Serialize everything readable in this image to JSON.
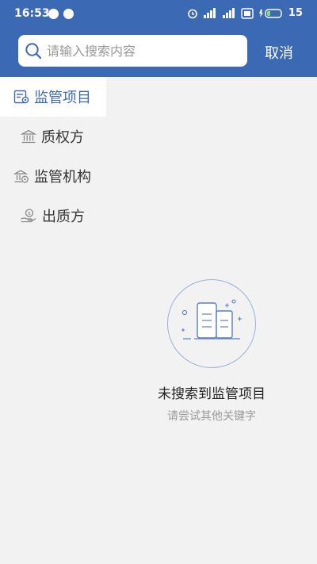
{
  "status_bar": {
    "time": "16:53",
    "battery": "15",
    "icons": [
      "message-icon",
      "media-icon",
      "alarm-icon",
      "signal-icon",
      "signal-icon",
      "sim-icon",
      "battery-icon"
    ]
  },
  "search": {
    "placeholder": "请输入搜索内容",
    "value": "",
    "cancel_label": "取消"
  },
  "categories": [
    {
      "label": "监管项目",
      "icon": "project-icon",
      "active": true
    },
    {
      "label": "质权方",
      "icon": "bank-icon",
      "active": false
    },
    {
      "label": "监管机构",
      "icon": "institution-icon",
      "active": false
    },
    {
      "label": "出质方",
      "icon": "pledgor-icon",
      "active": false
    }
  ],
  "empty_state": {
    "title": "未搜索到监管项目",
    "subtitle": "请尝试其他关键字"
  },
  "colors": {
    "header": "#3c69b3",
    "accent": "#3c69b3",
    "background": "#f2f2f2"
  }
}
